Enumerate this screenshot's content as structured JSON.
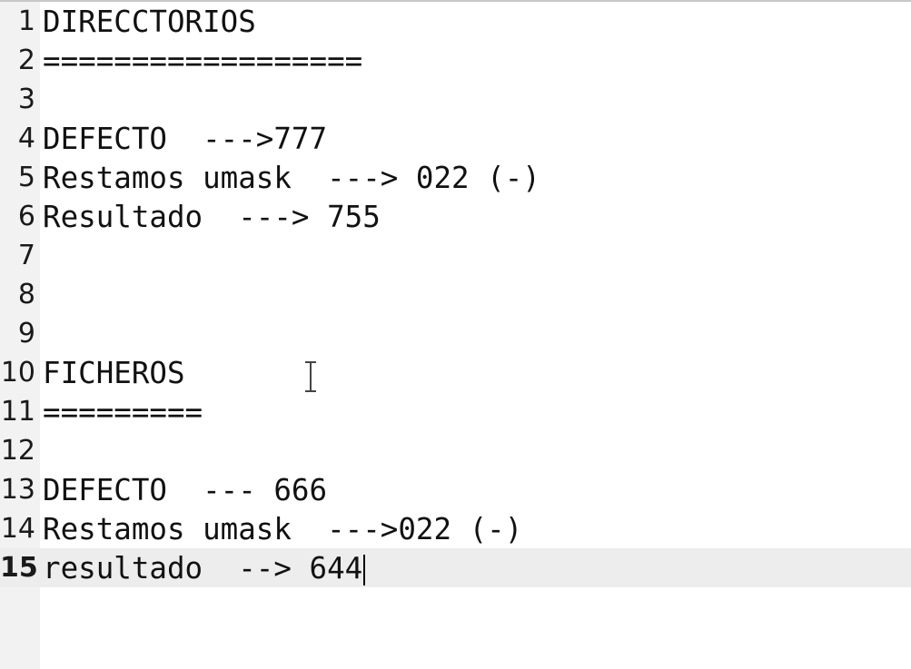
{
  "editor": {
    "lines": [
      {
        "number": "1",
        "text": "DIRECCTORIOS"
      },
      {
        "number": "2",
        "text": "=================="
      },
      {
        "number": "3",
        "text": ""
      },
      {
        "number": "4",
        "text": "DEFECTO  --->777"
      },
      {
        "number": "5",
        "text": "Restamos umask  ---> 022 (-)"
      },
      {
        "number": "6",
        "text": "Resultado  ---> 755"
      },
      {
        "number": "7",
        "text": ""
      },
      {
        "number": "8",
        "text": ""
      },
      {
        "number": "9",
        "text": ""
      },
      {
        "number": "10",
        "text": "FICHEROS"
      },
      {
        "number": "11",
        "text": "========="
      },
      {
        "number": "12",
        "text": ""
      },
      {
        "number": "13",
        "text": "DEFECTO  --- 666"
      },
      {
        "number": "14",
        "text": "Restamos umask  --->022 (-)"
      },
      {
        "number": "15",
        "text": "resultado  --> 644"
      }
    ],
    "current_line": 15
  }
}
